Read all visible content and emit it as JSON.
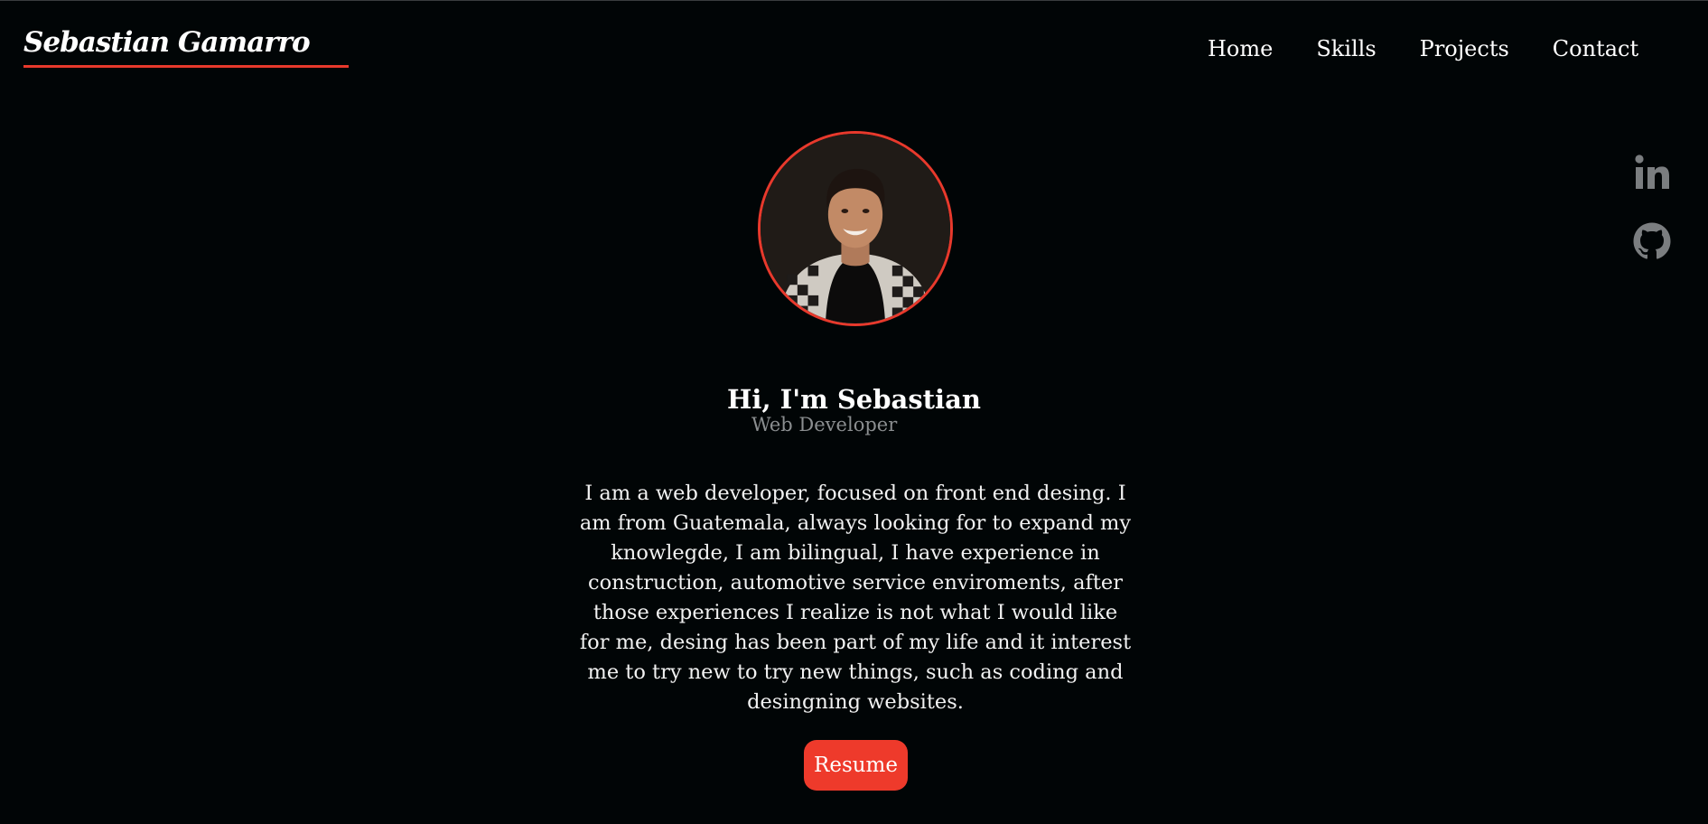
{
  "header": {
    "brand": "Sebastian Gamarro",
    "nav": [
      "Home",
      "Skills",
      "Projects",
      "Contact"
    ]
  },
  "social": {
    "icons": [
      "linkedin-icon",
      "github-icon"
    ],
    "icon_color": "#7b7e80"
  },
  "hero": {
    "greeting": "Hi, I'm Sebastian",
    "role": "Web Developer",
    "bio": "I am a web developer, focused on front end desing. I am from Guatemala, always looking for to expand my knowlegde, I am bilingual, I have experience in construction, automotive service enviroments, after those experiences I realize is not what I would like for me, desing has been part of my life and it interest me to try new to try new things, such as coding and desingning websites.",
    "button": "Resume"
  },
  "colors": {
    "background": "#010506",
    "accent": "#e8392c",
    "muted_text": "#8b8e90"
  }
}
